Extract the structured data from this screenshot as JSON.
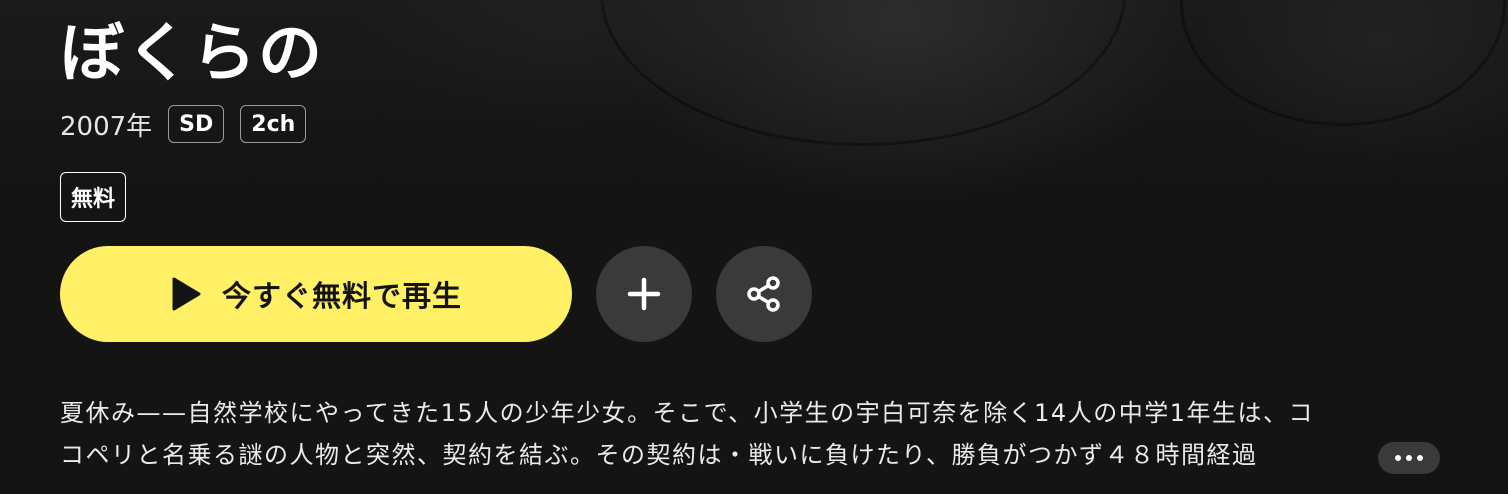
{
  "show": {
    "title": "ぼくらの",
    "year": "2007年",
    "badges": [
      "SD",
      "2ch"
    ],
    "price_badge": "無料"
  },
  "actions": {
    "play_label": "今すぐ無料で再生",
    "play_icon": "play-icon",
    "add_icon": "plus-icon",
    "share_icon": "share-icon",
    "accent_color": "#fff066"
  },
  "synopsis": {
    "line1": "夏休み——自然学校にやってきた15人の少年少女。そこで、小学生の宇白可奈を除く14人の中学1年生は、ココペリと名乗る謎の人物と突然、契約を結ぶ。その契約は・戦いに負けたり、勝負がつかず４８時間経過",
    "line1_visible": "夏休み——自然学校にやってきた15人の少年少女。そこで、小学生の宇白可奈を除く14人の中学1年生は、コ",
    "line2_visible": "コペリと名乗る謎の人物と突然、契約を結ぶ。その契約は・戦いに負けたり、勝負がつかず４８時間経過",
    "more_icon": "ellipsis-icon"
  }
}
